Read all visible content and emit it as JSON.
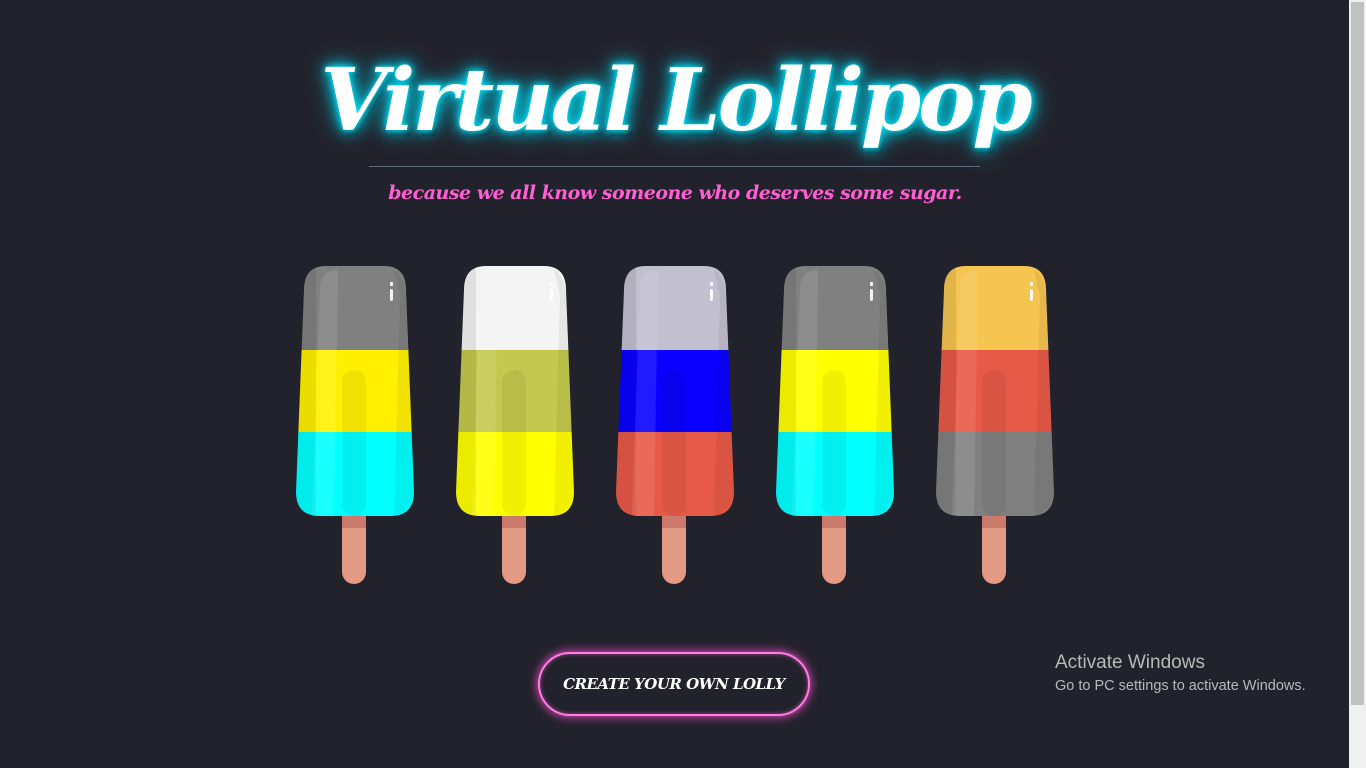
{
  "header": {
    "title": "Virtual Lollipop",
    "tagline": "because we all know someone who deserves some sugar."
  },
  "lollies": [
    {
      "top": "#808080",
      "middle": "#fff000",
      "bottom": "#00ffff"
    },
    {
      "top": "#f4f4f4",
      "middle": "#c4c84e",
      "bottom": "#ffff00"
    },
    {
      "top": "#c2bfd0",
      "middle": "#0a00ff",
      "bottom": "#e85a48"
    },
    {
      "top": "#808080",
      "middle": "#ffff00",
      "bottom": "#00ffff"
    },
    {
      "top": "#f5c451",
      "middle": "#e85a48",
      "bottom": "#808080"
    }
  ],
  "cta": {
    "label": "CREATE YOUR OWN LOLLY"
  },
  "watermark": {
    "line1": "Activate Windows",
    "line2": "Go to PC settings to activate Windows."
  },
  "colors": {
    "background": "#22222c",
    "title_glow": "#00e5ff",
    "accent_pink": "#ff5fd2",
    "stick": "#e29a84"
  }
}
